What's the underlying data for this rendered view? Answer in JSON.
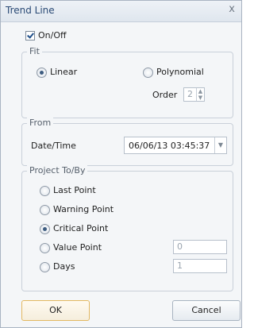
{
  "dialog": {
    "title": "Trend Line",
    "close_glyph": "x",
    "onoff_label": "On/Off",
    "onoff_checked": true
  },
  "fit": {
    "legend": "Fit",
    "linear_label": "Linear",
    "polynomial_label": "Polynomial",
    "selected": "Linear",
    "order_label": "Order",
    "order_value": "2"
  },
  "from": {
    "legend": "From",
    "datetime_label": "Date/Time",
    "datetime_value": "06/06/13 03:45:37"
  },
  "project": {
    "legend": "Project To/By",
    "options": [
      {
        "label": "Last Point"
      },
      {
        "label": "Warning Point"
      },
      {
        "label": "Critical Point"
      },
      {
        "label": "Value Point"
      },
      {
        "label": "Days"
      }
    ],
    "selected": "Critical Point",
    "value_point_value": "0",
    "days_value": "1"
  },
  "buttons": {
    "ok_label": "OK",
    "cancel_label": "Cancel"
  },
  "icons": {
    "close": "close-icon",
    "spin": "spin-arrows-icon",
    "dropdown": "chevron-down-icon"
  }
}
